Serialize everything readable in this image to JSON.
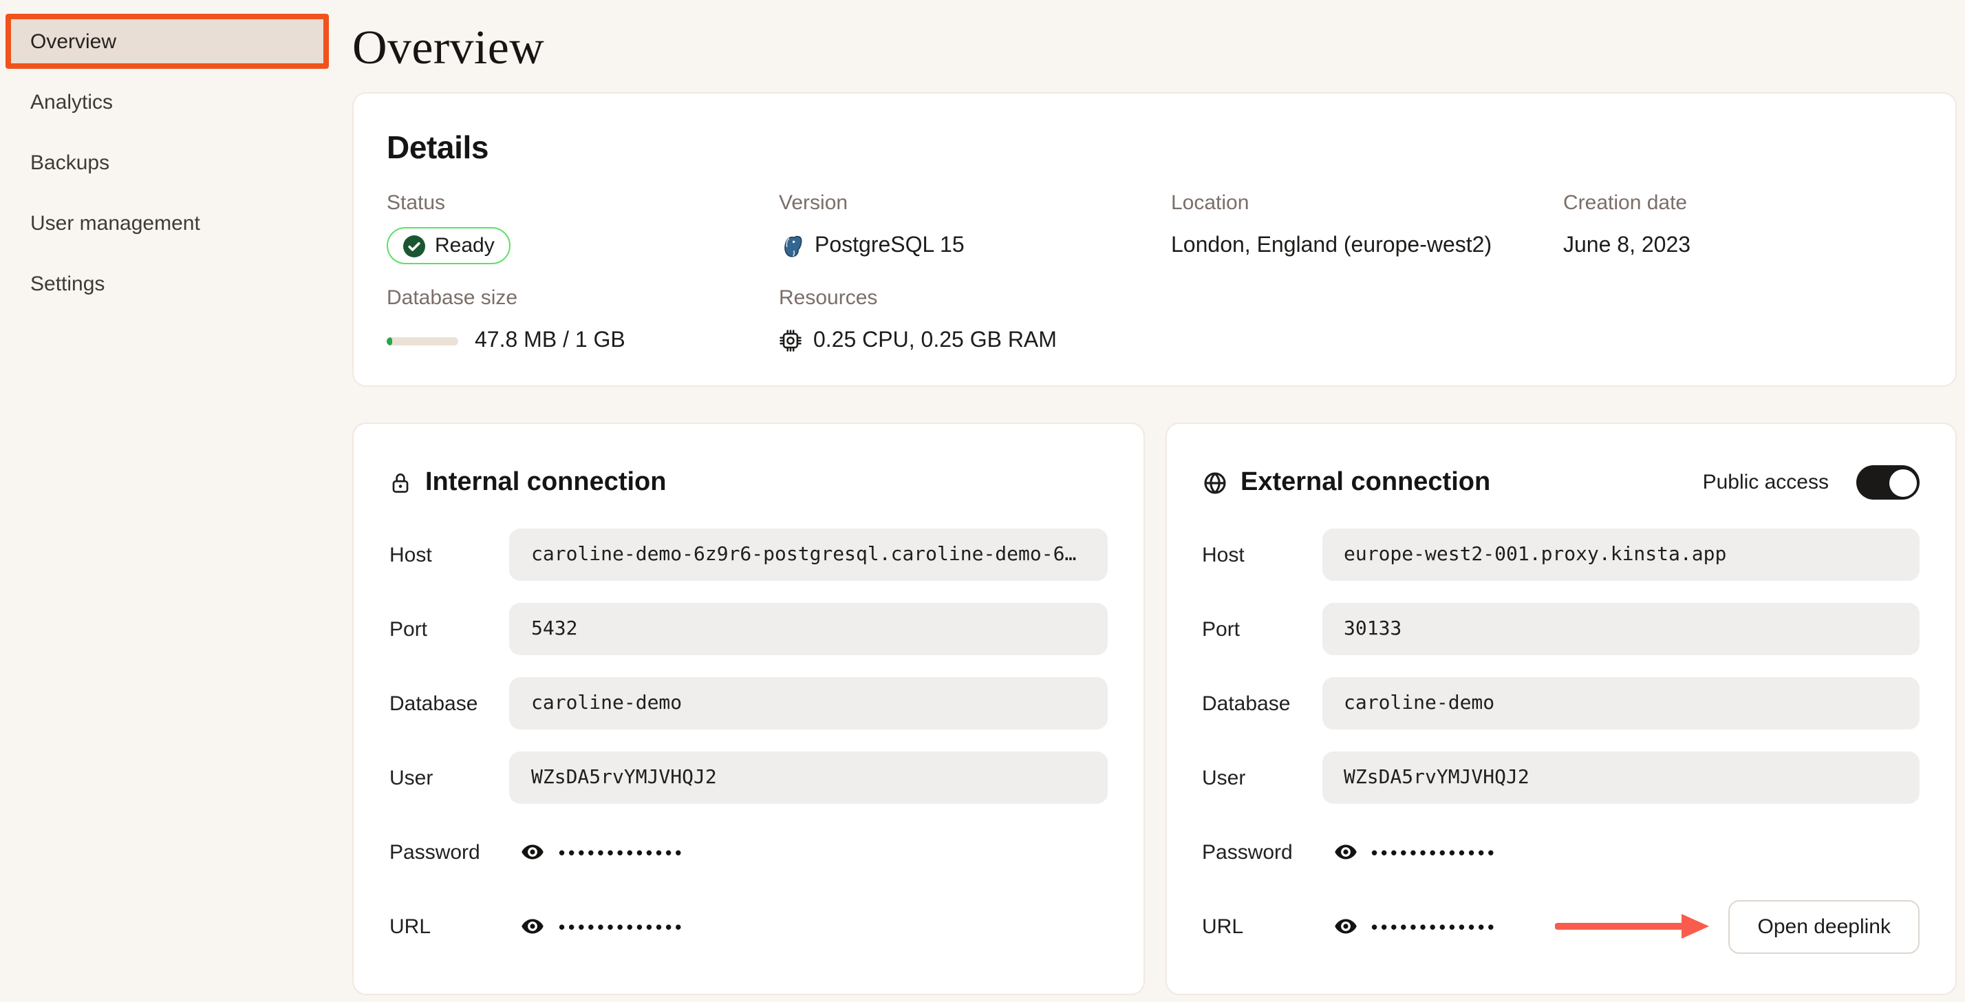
{
  "page": {
    "title": "Overview"
  },
  "sidebar": {
    "items": [
      {
        "label": "Overview",
        "active": true
      },
      {
        "label": "Analytics",
        "active": false
      },
      {
        "label": "Backups",
        "active": false
      },
      {
        "label": "User management",
        "active": false
      },
      {
        "label": "Settings",
        "active": false
      }
    ]
  },
  "details": {
    "title": "Details",
    "status": {
      "label": "Status",
      "value": "Ready",
      "icon": "check-circle-icon"
    },
    "version": {
      "label": "Version",
      "value": "PostgreSQL 15",
      "icon": "postgresql-icon"
    },
    "location": {
      "label": "Location",
      "value": "London, England (europe-west2)"
    },
    "creation_date": {
      "label": "Creation date",
      "value": "June 8, 2023"
    },
    "database_size": {
      "label": "Database size",
      "value": "47.8 MB / 1 GB",
      "progress_percent": 8
    },
    "resources": {
      "label": "Resources",
      "value": "0.25 CPU, 0.25 GB RAM",
      "icon": "cpu-icon"
    }
  },
  "internal_connection": {
    "title": "Internal connection",
    "icon": "lock-icon",
    "fields": [
      {
        "label": "Host",
        "value": "caroline-demo-6z9r6-postgresql.caroline-demo-6…"
      },
      {
        "label": "Port",
        "value": "5432"
      },
      {
        "label": "Database",
        "value": "caroline-demo"
      },
      {
        "label": "User",
        "value": "WZsDA5rvYMJVHQJ2"
      },
      {
        "label": "Password",
        "value": "•••••••••••••",
        "masked": true
      },
      {
        "label": "URL",
        "value": "•••••••••••••",
        "masked": true
      }
    ]
  },
  "external_connection": {
    "title": "External connection",
    "icon": "globe-icon",
    "public_access_label": "Public access",
    "public_access_on": true,
    "open_deeplink_label": "Open deeplink",
    "fields": [
      {
        "label": "Host",
        "value": "europe-west2-001.proxy.kinsta.app"
      },
      {
        "label": "Port",
        "value": "30133"
      },
      {
        "label": "Database",
        "value": "caroline-demo"
      },
      {
        "label": "User",
        "value": "WZsDA5rvYMJVHQJ2"
      },
      {
        "label": "Password",
        "value": "•••••••••••••",
        "masked": true
      },
      {
        "label": "URL",
        "value": "•••••••••••••",
        "masked": true
      }
    ]
  },
  "colors": {
    "accent_orange": "#f0531c",
    "annotation_red": "#f95c4c",
    "badge_green_border": "#5ce065",
    "badge_green_fill": "#1a5632",
    "progress_green": "#27a74a",
    "postgres_blue": "#336791",
    "toggle_on": "#1b1918"
  }
}
